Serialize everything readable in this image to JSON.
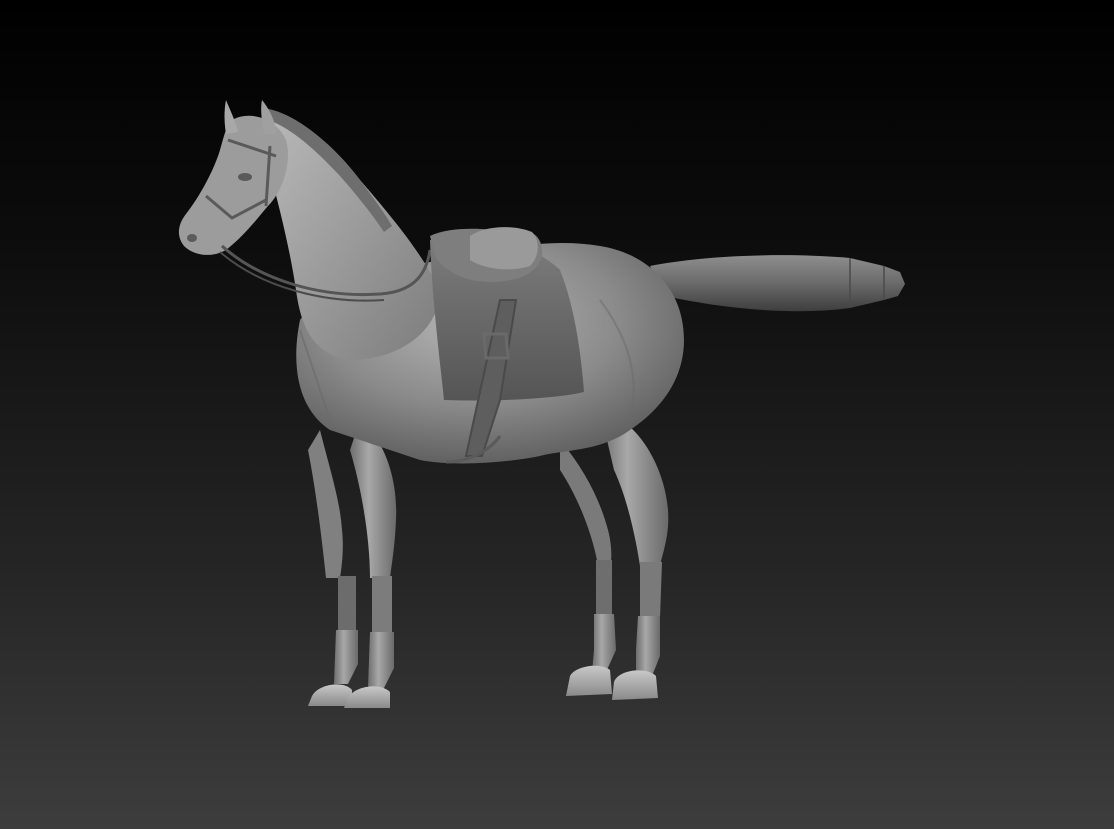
{
  "viewport": {
    "model_subject": "saddled-horse-sculpt",
    "background_top_color": "#000000",
    "background_bottom_color": "#3d3d3d",
    "material_color": "#8c8c8c"
  }
}
